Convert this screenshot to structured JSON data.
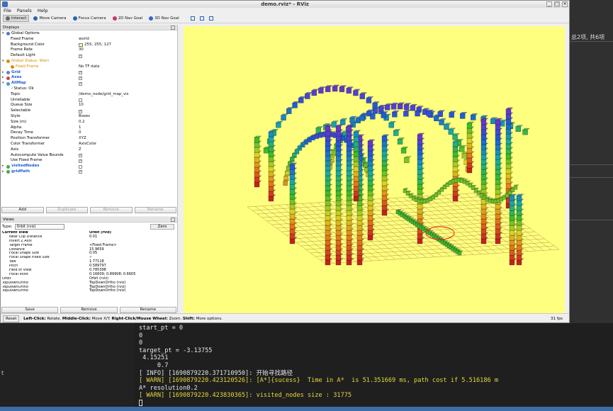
{
  "window": {
    "title": "demo.rviz* - RViz"
  },
  "menu": [
    "File",
    "Panels",
    "Help"
  ],
  "toolbar": [
    {
      "label": "Interact",
      "icon": "interact-icon",
      "active": true
    },
    {
      "label": "Move Camera",
      "icon": "move-camera-icon",
      "active": false
    },
    {
      "label": "Focus Camera",
      "icon": "focus-camera-icon",
      "active": false
    },
    {
      "label": "2D Nav Goal",
      "icon": "nav-goal-icon",
      "active": false
    },
    {
      "label": "3D Nav Goal",
      "icon": "nav-goal-3d-icon",
      "active": false
    }
  ],
  "displays": {
    "title": "Displays",
    "rows": [
      {
        "name": "Global Options",
        "value": "",
        "kind": "group",
        "icon": "#4a7cc7"
      },
      {
        "name": "Fixed Frame",
        "value": "world",
        "kind": "prop"
      },
      {
        "name": "Background Color",
        "value": "255; 255; 127",
        "kind": "prop",
        "swatch": true
      },
      {
        "name": "Frame Rate",
        "value": "30",
        "kind": "prop"
      },
      {
        "name": "Default Light",
        "value": "✓",
        "kind": "prop",
        "check": true
      },
      {
        "name": "Global Status: Warn",
        "value": "",
        "kind": "warn",
        "icon": "#e08a00"
      },
      {
        "name": "Fixed Frame",
        "value": "No TF data",
        "kind": "warnsub",
        "icon": "#e08a00"
      },
      {
        "name": "Grid",
        "value": "✓",
        "kind": "display",
        "icon": "#5588cc",
        "check": true
      },
      {
        "name": "Axes",
        "value": "✓",
        "kind": "display",
        "icon": "#cc4444",
        "check": true
      },
      {
        "name": "AllMap",
        "value": "✓",
        "kind": "display",
        "icon": "#3aa0d8",
        "check": true
      },
      {
        "name": "Status: Ok",
        "value": "",
        "kind": "status"
      },
      {
        "name": "Topic",
        "value": "/demo_node/grid_map_vis",
        "kind": "prop"
      },
      {
        "name": "Unreliable",
        "value": "",
        "kind": "prop",
        "check": true
      },
      {
        "name": "Queue Size",
        "value": "10",
        "kind": "prop"
      },
      {
        "name": "Selectable",
        "value": "✓",
        "kind": "prop",
        "check": true
      },
      {
        "name": "Style",
        "value": "Boxes",
        "kind": "prop"
      },
      {
        "name": "Size (m)",
        "value": "0.2",
        "kind": "prop"
      },
      {
        "name": "Alpha",
        "value": "1",
        "kind": "prop"
      },
      {
        "name": "Decay Time",
        "value": "0",
        "kind": "prop"
      },
      {
        "name": "Position Transformer",
        "value": "XYZ",
        "kind": "prop"
      },
      {
        "name": "Color Transformer",
        "value": "AxisColor",
        "kind": "prop"
      },
      {
        "name": "Axis",
        "value": "Z",
        "kind": "prop"
      },
      {
        "name": "Autocompute Value Bounds",
        "value": "✓",
        "kind": "prop",
        "check": true
      },
      {
        "name": "Use Fixed Frame",
        "value": "✓",
        "kind": "prop",
        "check": true
      },
      {
        "name": "visitedNodes",
        "value": "",
        "kind": "display2",
        "icon": "#44aa44",
        "check": true
      },
      {
        "name": "gridPath",
        "value": "✓",
        "kind": "display",
        "icon": "#44aa44",
        "check": true
      }
    ],
    "buttons": [
      {
        "label": "Add",
        "enabled": true
      },
      {
        "label": "Duplicate",
        "enabled": false
      },
      {
        "label": "Remove",
        "enabled": false
      },
      {
        "label": "Rename",
        "enabled": false
      }
    ]
  },
  "views": {
    "title": "Views",
    "type_label": "Type:",
    "type_value": "Orbit (rviz)",
    "zero_label": "Zero",
    "rows": [
      {
        "name": "Current View",
        "value": "Orbit (rviz)",
        "kind": "head"
      },
      {
        "name": "Near Clip Distance",
        "value": "0.01"
      },
      {
        "name": "Invert Z Axis",
        "value": ""
      },
      {
        "name": "Target Frame",
        "value": "<Fixed Frame>"
      },
      {
        "name": "Distance",
        "value": "15.9659"
      },
      {
        "name": "Focal Shape Size",
        "value": "0.05"
      },
      {
        "name": "Focal Shape Fixed Size",
        "value": "✓"
      },
      {
        "name": "Yaw",
        "value": "1.77118"
      },
      {
        "name": "Pitch",
        "value": "0.589797"
      },
      {
        "name": "Field of View",
        "value": "0.785398"
      },
      {
        "name": "Focal Point",
        "value": "0.16609; 0.89908; 0.6605"
      },
      {
        "name": "Orbit",
        "value": "Orbit (rviz)",
        "kind": "sub"
      },
      {
        "name": "TopDownOrtho",
        "value": "TopDownOrtho (rviz)",
        "kind": "sub"
      },
      {
        "name": "TopDownOrtho",
        "value": "TopDownOrtho (rviz)",
        "kind": "sub"
      },
      {
        "name": "TopDownOrtho",
        "value": "TopDownOrtho (rviz)",
        "kind": "sub"
      }
    ],
    "buttons": [
      {
        "label": "Save"
      },
      {
        "label": "Remove"
      },
      {
        "label": "Rename"
      }
    ]
  },
  "status": {
    "reset": "Reset",
    "left_key": "Left-Click:",
    "left_val": "Rotate.",
    "mid_key": "Middle-Click:",
    "mid_val": "Move X/Y.",
    "right_key": "Right-Click/Mouse Wheel:",
    "right_val": "Zoom.",
    "shift_key": "Shift:",
    "shift_val": "More options.",
    "fps": "31 fps"
  },
  "terminal": {
    "lines": [
      {
        "text": "start_pt = 0",
        "warn": false
      },
      {
        "text": "0",
        "warn": false
      },
      {
        "text": "0",
        "warn": false
      },
      {
        "text": "target_pt = -3.13755",
        "warn": false
      },
      {
        "text": " 4.15251",
        "warn": false
      },
      {
        "text": "     0.7",
        "warn": false
      },
      {
        "text": "[ INFO] [1690879220.371710950]: 开始寻找路径",
        "warn": false
      },
      {
        "text": "[ WARN] [1690879220.423120526]: [A*]{sucess}  Time in A*  is 51.351669 ms, path cost if 5.516186 m",
        "warn": true
      },
      {
        "text": "A* resolution0.2",
        "warn": false
      },
      {
        "text": "[ WARN] [1690879220.423830365]: visited_nodes size : 31775",
        "warn": true
      }
    ]
  },
  "side": {
    "text": "总2项, 共6项",
    "left_char": "t"
  }
}
